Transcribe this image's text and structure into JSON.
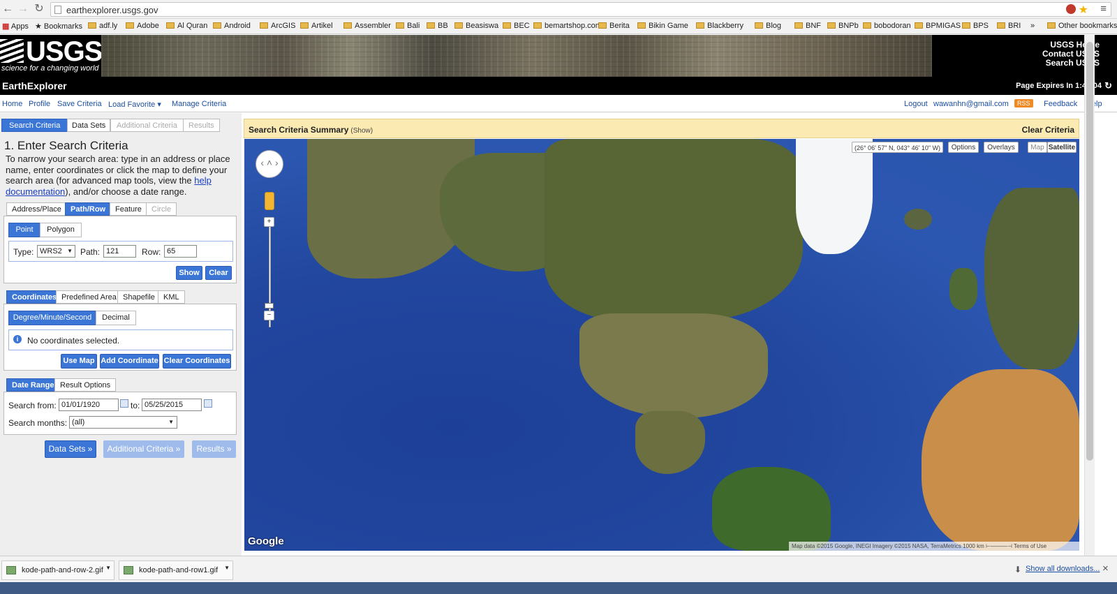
{
  "browser": {
    "url": "earthexplorer.usgs.gov",
    "bookmarks": [
      "Apps",
      "Bookmarks",
      "adf.ly",
      "Adobe",
      "Al Quran",
      "Android",
      "ArcGIS",
      "Artikel",
      "Assembler",
      "Bali",
      "BB",
      "Beasiswa",
      "BEC",
      "bemartshop.com",
      "Berita",
      "Bikin Game",
      "Blackberry",
      "Blog",
      "BNF",
      "BNPb",
      "bobodoran",
      "BPMIGAS",
      "BPS",
      "BRI"
    ],
    "overflow": "»",
    "other_bookmarks": "Other bookmarks"
  },
  "banner": {
    "logo": "USGS",
    "tagline": "science for a changing world",
    "links": [
      "USGS Home",
      "Contact USGS",
      "Search USGS"
    ]
  },
  "titlebar": {
    "title": "EarthExplorer",
    "expires": "Page Expires In 1:47:04"
  },
  "topnav": {
    "left": [
      "Home",
      "Profile",
      "Save Criteria",
      "Load Favorite ▾",
      "Manage Criteria"
    ],
    "logout": "Logout",
    "user": "wawanhn@gmail.com",
    "rss": "RSS",
    "feedback": "Feedback",
    "help": "Help"
  },
  "main_tabs": [
    "Search Criteria",
    "Data Sets",
    "Additional Criteria",
    "Results"
  ],
  "step": {
    "title": "1. Enter Search Criteria",
    "desc_before": "To narrow your search area: type in an address or place name, enter coordinates or click the map to define your search area (for advanced map tools, view the ",
    "desc_link": "help documentation",
    "desc_after": "), and/or choose a date range."
  },
  "area_tabs": [
    "Address/Place",
    "Path/Row",
    "Feature",
    "Circle"
  ],
  "pathrow": {
    "modes": [
      "Point",
      "Polygon"
    ],
    "type_label": "Type:",
    "type_value": "WRS2",
    "path_label": "Path:",
    "path_value": "121",
    "row_label": "Row:",
    "row_value": "65",
    "show": "Show",
    "clear": "Clear"
  },
  "coord_tabs": [
    "Coordinates",
    "Predefined Area",
    "Shapefile",
    "KML"
  ],
  "coords": {
    "formats": [
      "Degree/Minute/Second",
      "Decimal"
    ],
    "empty": "No coordinates selected.",
    "use_map": "Use Map",
    "add": "Add Coordinate",
    "clear": "Clear Coordinates"
  },
  "date_tabs": [
    "Date Range",
    "Result Options"
  ],
  "dates": {
    "from_label": "Search from:",
    "from_value": "01/01/1920",
    "to_label": "to:",
    "to_value": "05/25/2015",
    "months_label": "Search months:",
    "months_value": "(all)"
  },
  "bottom_buttons": [
    "Data Sets »",
    "Additional Criteria »",
    "Results »"
  ],
  "summary": {
    "title": "Search Criteria Summary",
    "show": "(Show)",
    "clear": "Clear Criteria"
  },
  "map": {
    "coord_readout": "(26° 06' 57\" N, 043° 46' 10\" W)",
    "options": "Options",
    "overlays": "Overlays",
    "map": "Map",
    "satellite": "Satellite",
    "google": "Google",
    "credit": "Map data ©2015 Google, INEGI Imagery ©2015 NASA, TerraMetrics    1000 km ⊢———⊣    Terms of Use"
  },
  "downloads": {
    "files": [
      "kode-path-and-row-2.gif",
      "kode-path-and-row1.gif"
    ],
    "show_all": "Show all downloads...",
    "close": "×"
  },
  "colors": {
    "accent": "#3b76d6",
    "summary_bg": "#fbeab2",
    "link": "#1c4ea0"
  }
}
